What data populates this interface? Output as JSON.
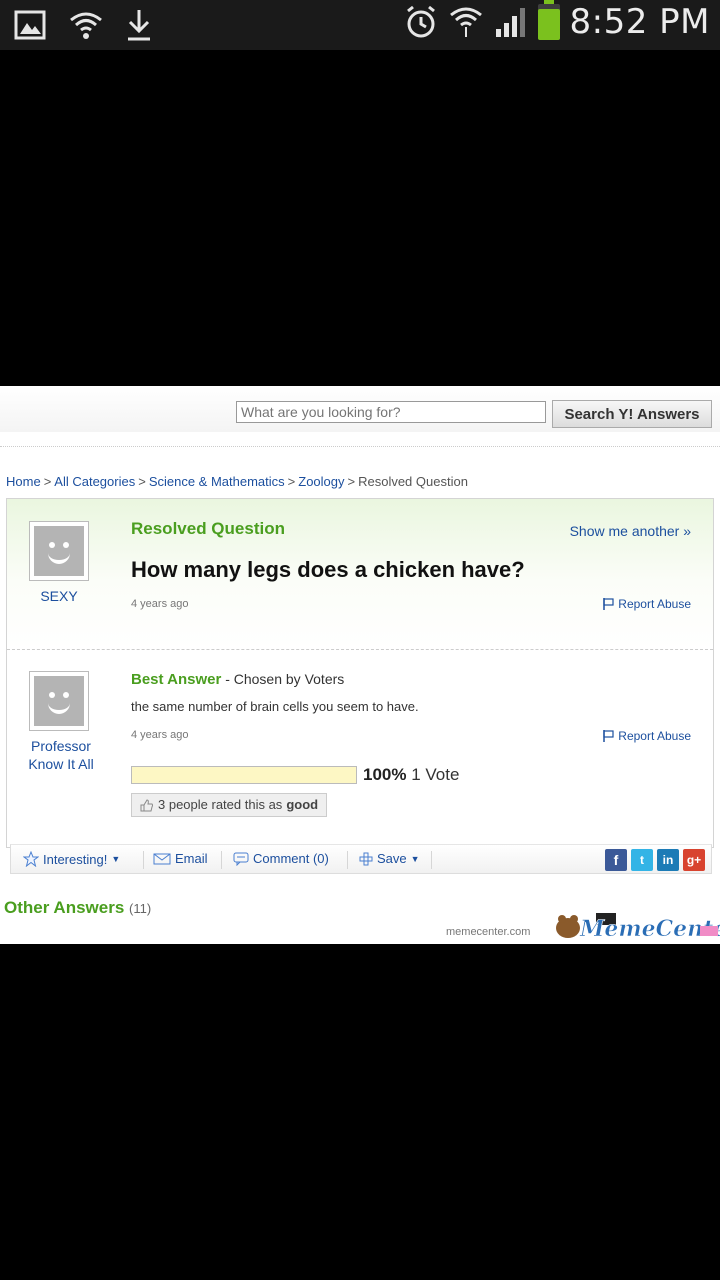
{
  "status_bar": {
    "time": "8:52 PM",
    "icons": [
      "gallery-icon",
      "wifi-question-icon",
      "download-icon",
      "alarm-icon",
      "wifi-icon",
      "signal-icon",
      "battery-icon"
    ],
    "battery_color": "#7bc11e"
  },
  "search": {
    "placeholder": "What are you looking for?",
    "button": "Search Y! Answers"
  },
  "breadcrumb": {
    "items": [
      "Home",
      "All Categories",
      "Science & Mathematics",
      "Zoology"
    ],
    "separator": ">",
    "current": "Resolved Question"
  },
  "question": {
    "status": "Resolved Question",
    "asker": "SEXY",
    "title": "How many legs does a chicken have?",
    "time": "4 years ago",
    "show_another": "Show me another »",
    "report": "Report Abuse"
  },
  "answer": {
    "label": "Best Answer",
    "chosen": " - Chosen by Voters",
    "text": "the same number of brain cells you seem to have.",
    "time": "4 years ago",
    "author_line1": "Professor",
    "author_line2": "Know It All",
    "report": "Report Abuse",
    "vote_percent": "100%",
    "vote_fraction": 1.0,
    "vote_count": "1 Vote",
    "rated_prefix": "3 people rated this as",
    "rated_value": "good"
  },
  "toolbar": {
    "interesting": "Interesting!",
    "email": "Email",
    "comment": "Comment (0)",
    "save": "Save"
  },
  "social": [
    "f",
    "t",
    "in",
    "g+"
  ],
  "other_answers": {
    "label": "Other Answers",
    "count": "(11)"
  },
  "watermark": {
    "site": "memecenter.com",
    "logo": "MemeCenter"
  },
  "colors": {
    "accent_green": "#4a9e1f",
    "link_blue": "#1c4f9e"
  }
}
